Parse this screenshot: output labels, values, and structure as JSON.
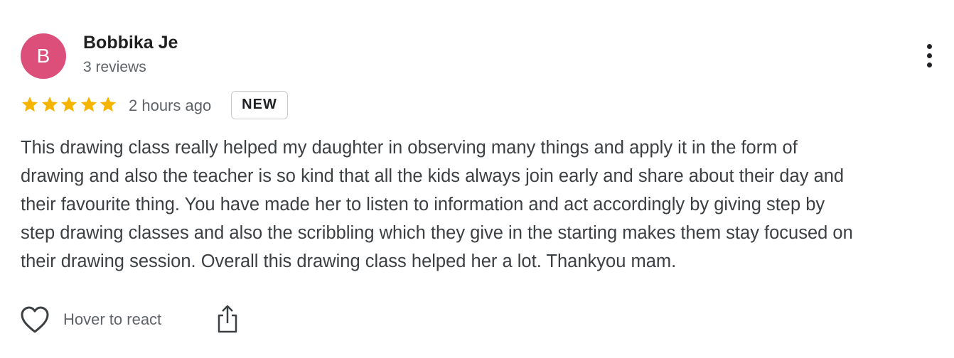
{
  "reviewer": {
    "avatar_letter": "B",
    "avatar_color": "#dc4f7a",
    "name": "Bobbika Je",
    "review_count": "3 reviews"
  },
  "rating": {
    "stars": 5,
    "star_color": "#f4b400",
    "time_ago": "2 hours ago",
    "badge": "NEW"
  },
  "review": {
    "lines": [
      "This drawing class really helped my daughter in observing many things and apply it in the form of",
      "drawing and also the teacher is so kind that all the kids always join early and share about their day and",
      "their favourite thing. You have made her to listen to information and act accordingly by giving step by",
      "step drawing classes and also the scribbling which they give in the starting makes them stay focused on",
      "their drawing session. Overall this drawing class helped her a lot. Thankyou mam."
    ]
  },
  "actions": {
    "react_icon": "heart-icon",
    "react_label": "Hover to react",
    "share_icon": "share-icon",
    "more_icon": "more-vertical-icon"
  }
}
